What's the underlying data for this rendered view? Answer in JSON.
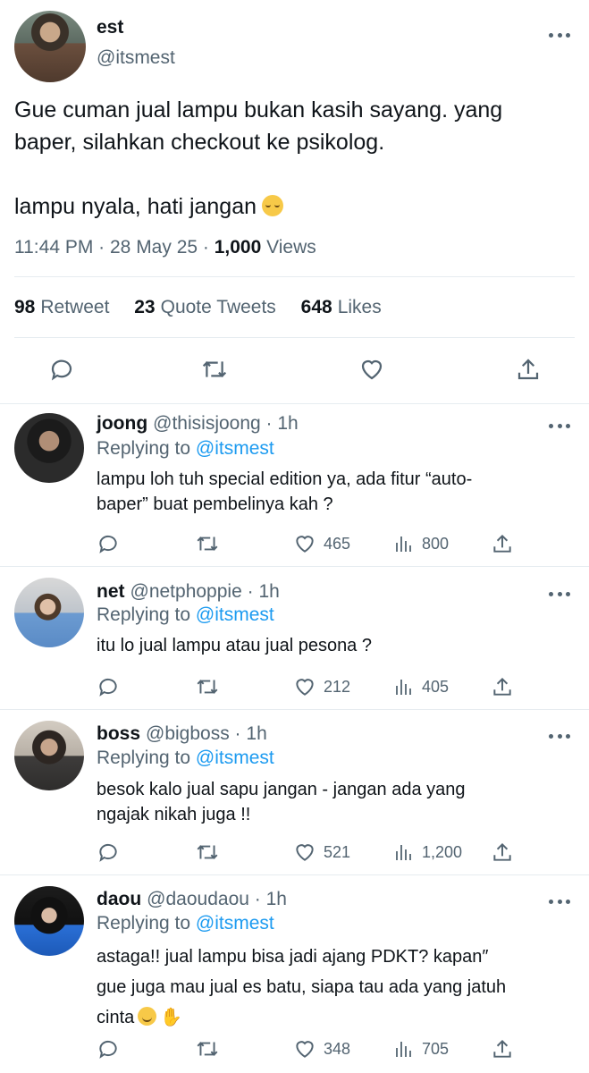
{
  "main": {
    "name": "est",
    "handle": "@itsmest",
    "text_lines": [
      "Gue cuman jual lampu bukan kasih sayang. yang",
      "baper, silahkan checkout ke psikolog.",
      "",
      "lampu nyala, hati jangan"
    ],
    "emoji": "relieved-face",
    "time": "11:44 PM",
    "date": "28 May 25",
    "views": "1,000",
    "views_label": "Views",
    "retweets": "98",
    "retweets_label": "Retweet",
    "quotes": "23",
    "quotes_label": "Quote Tweets",
    "likes": "648",
    "likes_label": "Likes"
  },
  "replying_label": "Replying to",
  "replying_target": "@itsmest",
  "replies": [
    {
      "name": "joong",
      "handle": "@thisisjoong",
      "time": "1h",
      "lines": [
        "lampu loh tuh special edition ya, ada fitur “auto-",
        "baper” buat pembelinya kah ?"
      ],
      "likes": "465",
      "views": "800"
    },
    {
      "name": "net",
      "handle": "@netphoppie",
      "time": "1h",
      "lines": [
        "itu lo jual lampu atau jual pesona ?"
      ],
      "likes": "212",
      "views": "405"
    },
    {
      "name": "boss",
      "handle": "@bigboss",
      "time": "1h",
      "lines": [
        "besok kalo jual sapu jangan - jangan ada yang",
        "ngajak nikah juga !!"
      ],
      "likes": "521",
      "views": "1,200"
    },
    {
      "name": "daou",
      "handle": "@daoudaou",
      "time": "1h",
      "lines": [
        "astaga!! jual lampu bisa jadi ajang PDKT? kapan″",
        "gue juga mau jual es batu, siapa tau ada yang jatuh",
        "cinta"
      ],
      "likes": "348",
      "views": "705",
      "emojis": [
        "smiling-face",
        "waving-hand"
      ]
    }
  ],
  "colors": {
    "text": "#0f1419",
    "secondary": "#536471",
    "link": "#1d9bf0",
    "divider": "#e6ecf0"
  }
}
